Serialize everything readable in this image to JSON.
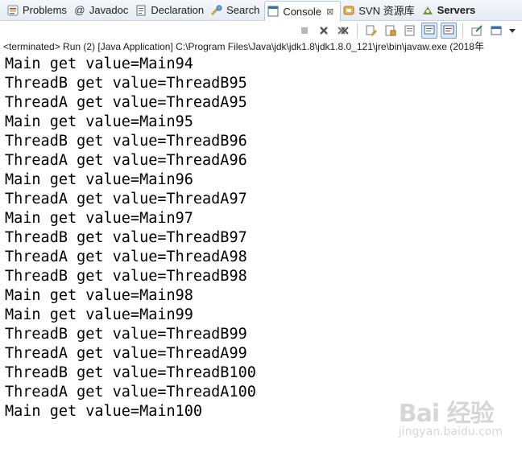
{
  "tabs": [
    {
      "label": "Problems",
      "icon": "problems-icon"
    },
    {
      "label": "Javadoc",
      "icon": "javadoc-icon"
    },
    {
      "label": "Declaration",
      "icon": "declaration-icon"
    },
    {
      "label": "Search",
      "icon": "search-icon"
    },
    {
      "label": "Console",
      "icon": "console-icon",
      "active": true,
      "close": "⊠"
    },
    {
      "label": "SVN 资源库",
      "icon": "svn-icon"
    },
    {
      "label": "Servers",
      "icon": "servers-icon"
    }
  ],
  "status_line": "<terminated> Run (2) [Java Application] C:\\Program Files\\Java\\jdk\\jdk1.8\\jdk1.8.0_121\\jre\\bin\\javaw.exe (2018年",
  "console_lines": [
    "Main get value=Main94",
    "ThreadB get value=ThreadB95",
    "ThreadA get value=ThreadA95",
    "Main get value=Main95",
    "ThreadB get value=ThreadB96",
    "ThreadA get value=ThreadA96",
    "Main get value=Main96",
    "ThreadA get value=ThreadA97",
    "Main get value=Main97",
    "ThreadB get value=ThreadB97",
    "ThreadA get value=ThreadA98",
    "ThreadB get value=ThreadB98",
    "Main get value=Main98",
    "Main get value=Main99",
    "ThreadB get value=ThreadB99",
    "ThreadA get value=ThreadA99",
    "ThreadB get value=ThreadB100",
    "ThreadA get value=ThreadA100",
    "Main get value=Main100"
  ],
  "watermark": {
    "brand": "Bai 经验",
    "url": "jingyan.baidu.com"
  }
}
